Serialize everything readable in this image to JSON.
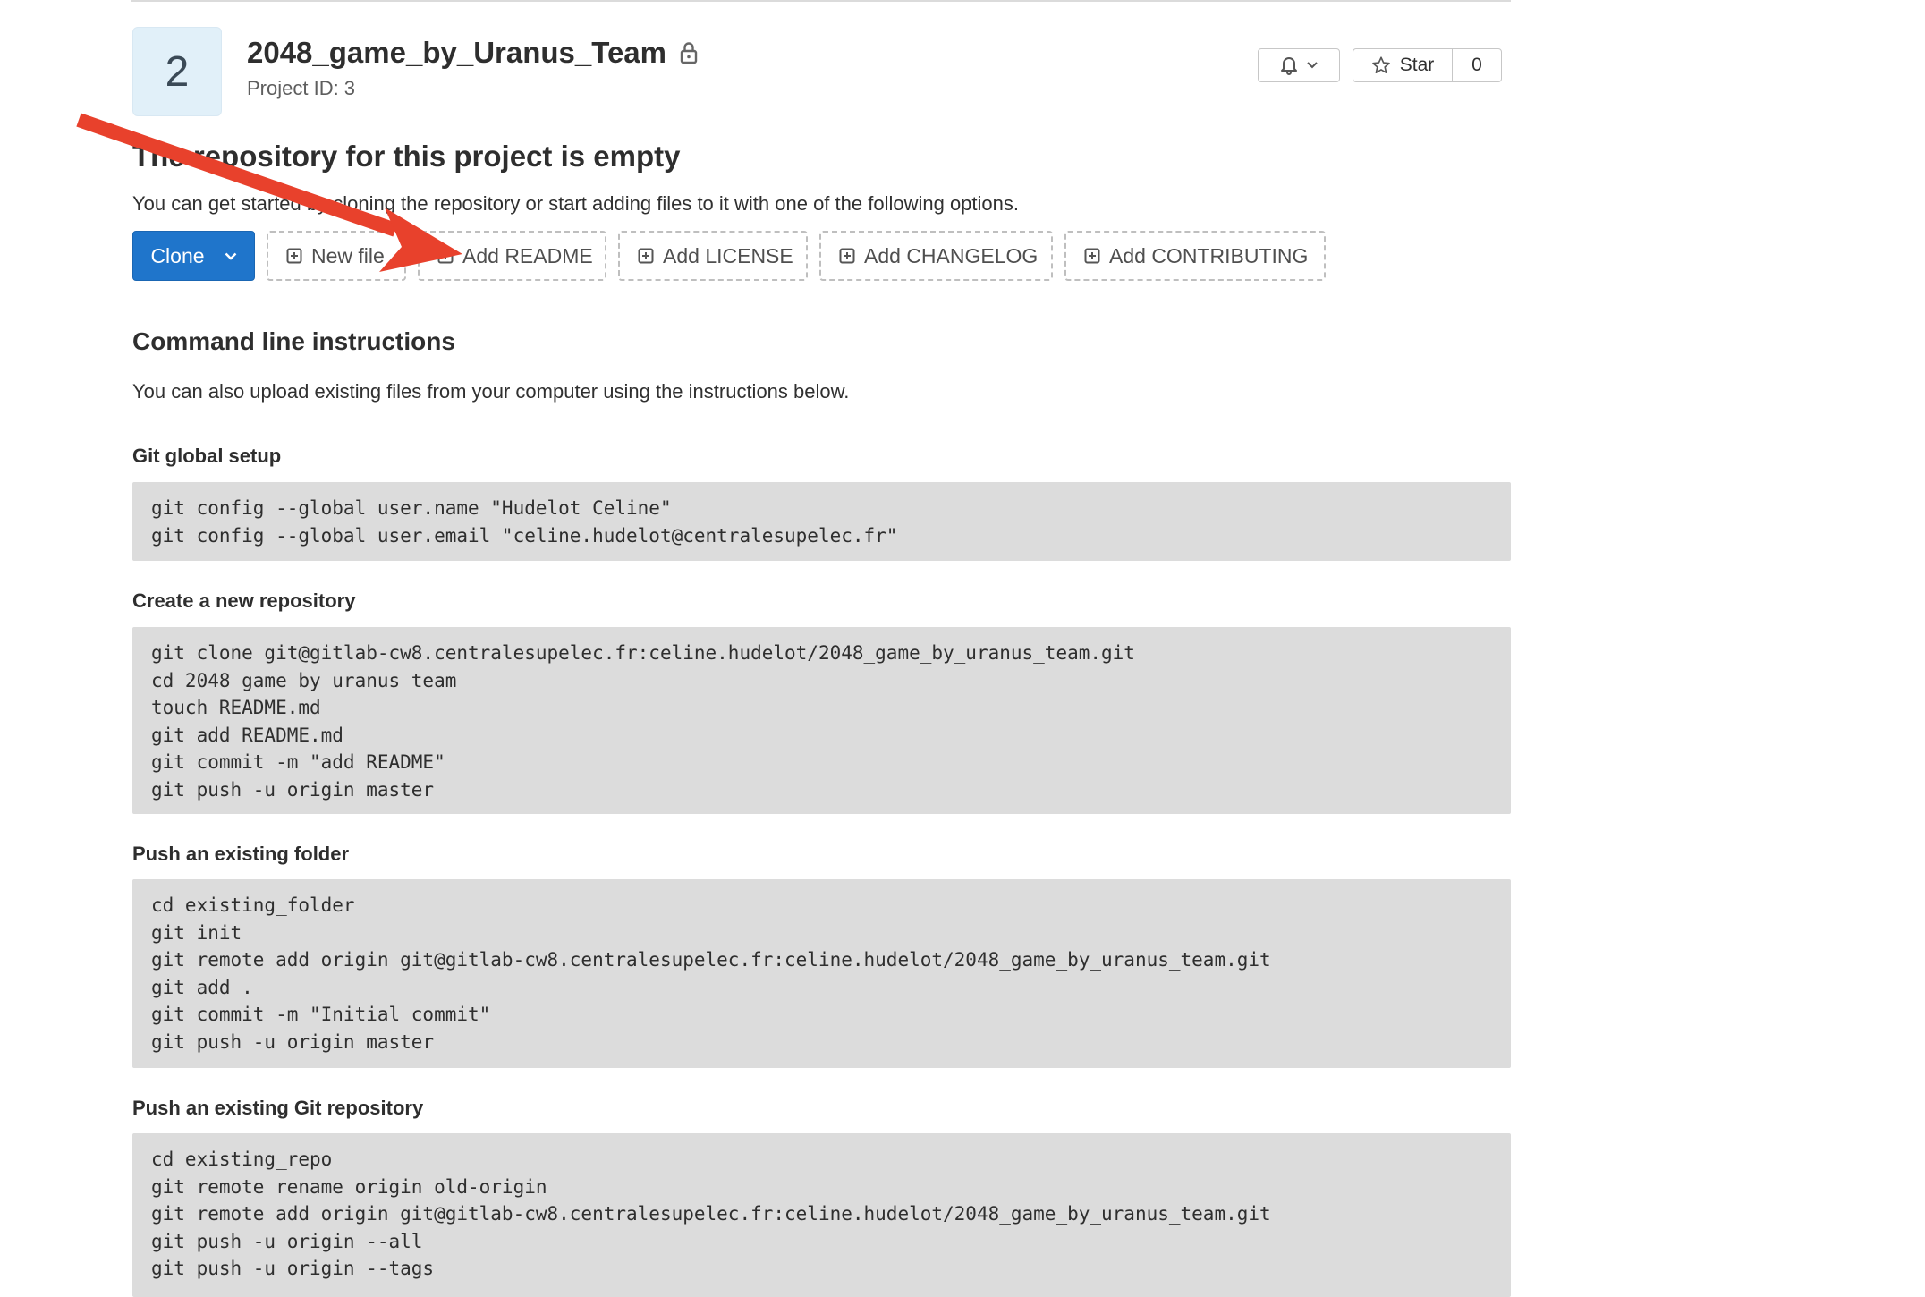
{
  "project": {
    "avatar_letter": "2",
    "name": "2048_game_by_Uranus_Team",
    "id_label": "Project ID: 3"
  },
  "header_actions": {
    "star_label": "Star",
    "star_count": "0"
  },
  "empty_state": {
    "heading": "The repository for this project is empty",
    "description": "You can get started by cloning the repository or start adding files to it with one of the following options."
  },
  "actions": {
    "clone_label": "Clone",
    "new_file_label": "New file",
    "add_readme_label": "Add README",
    "add_license_label": "Add LICENSE",
    "add_changelog_label": "Add CHANGELOG",
    "add_contributing_label": "Add CONTRIBUTING"
  },
  "cli": {
    "heading": "Command line instructions",
    "description": "You can also upload existing files from your computer using the instructions below.",
    "sections": [
      {
        "title": "Git global setup",
        "lines": [
          "git config --global user.name \"Hudelot Celine\"",
          "git config --global user.email \"celine.hudelot@centralesupelec.fr\""
        ]
      },
      {
        "title": "Create a new repository",
        "lines": [
          "git clone git@gitlab-cw8.centralesupelec.fr:celine.hudelot/2048_game_by_uranus_team.git",
          "cd 2048_game_by_uranus_team",
          "touch README.md",
          "git add README.md",
          "git commit -m \"add README\"",
          "git push -u origin master"
        ]
      },
      {
        "title": "Push an existing folder",
        "lines": [
          "cd existing_folder",
          "git init",
          "git remote add origin git@gitlab-cw8.centralesupelec.fr:celine.hudelot/2048_game_by_uranus_team.git",
          "git add .",
          "git commit -m \"Initial commit\"",
          "git push -u origin master"
        ]
      },
      {
        "title": "Push an existing Git repository",
        "lines": [
          "cd existing_repo",
          "git remote rename origin old-origin",
          "git remote add origin git@gitlab-cw8.centralesupelec.fr:celine.hudelot/2048_game_by_uranus_team.git",
          "git push -u origin --all",
          "git push -u origin --tags"
        ]
      }
    ]
  },
  "colors": {
    "primary": "#1f75cb",
    "code_bg": "#dcdcdc",
    "avatar_bg": "#e1f0f9",
    "annotation_arrow": "#e8412c"
  },
  "icons": {
    "lock": "lock-icon",
    "notification": "bell-icon",
    "star": "star-icon",
    "chevron": "chevron-down-icon",
    "plus_square": "plus-square-icon"
  }
}
